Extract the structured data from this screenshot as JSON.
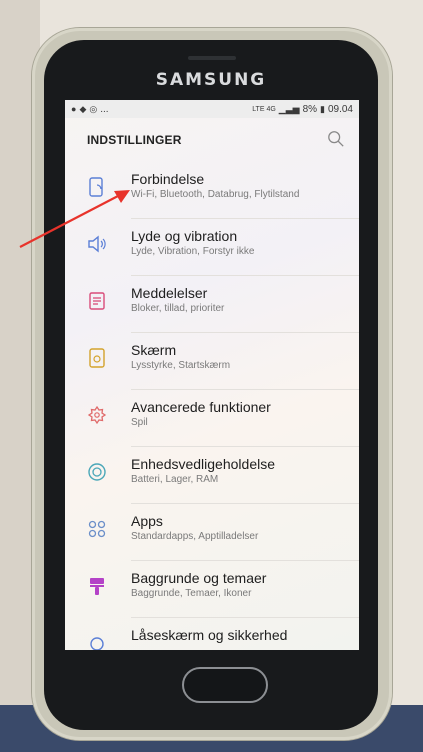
{
  "device": {
    "brand": "SAMSUNG"
  },
  "status_bar": {
    "left_icons_text": "...",
    "network": "LTE 4G",
    "battery": "8%",
    "time": "09.04"
  },
  "header": {
    "title": "INDSTILLINGER",
    "search_icon": "search-icon"
  },
  "settings": [
    {
      "title": "Forbindelse",
      "subtitle": "Wi-Fi, Bluetooth, Databrug, Flytilstand",
      "icon": "connections-icon",
      "color": "#5b7fd6"
    },
    {
      "title": "Lyde og vibration",
      "subtitle": "Lyde, Vibration, Forstyr ikke",
      "icon": "sound-icon",
      "color": "#5b7fd6"
    },
    {
      "title": "Meddelelser",
      "subtitle": "Bloker, tillad, prioriter",
      "icon": "notifications-icon",
      "color": "#d94c7a"
    },
    {
      "title": "Skærm",
      "subtitle": "Lysstyrke, Startskærm",
      "icon": "display-icon",
      "color": "#d3a32c"
    },
    {
      "title": "Avancerede funktioner",
      "subtitle": "Spil",
      "icon": "advanced-features-icon",
      "color": "#e06a6a"
    },
    {
      "title": "Enhedsvedligeholdelse",
      "subtitle": "Batteri, Lager, RAM",
      "icon": "device-maintenance-icon",
      "color": "#4aa7b8"
    },
    {
      "title": "Apps",
      "subtitle": "Standardapps, Apptilladelser",
      "icon": "apps-icon",
      "color": "#6b8fc9"
    },
    {
      "title": "Baggrunde og temaer",
      "subtitle": "Baggrunde, Temaer, Ikoner",
      "icon": "themes-icon",
      "color": "#b442c7"
    },
    {
      "title": "Låseskærm og sikkerhed",
      "subtitle": "",
      "icon": "lock-screen-icon",
      "color": "#5b7fd6"
    }
  ],
  "annotation": {
    "color": "#e8332b"
  }
}
